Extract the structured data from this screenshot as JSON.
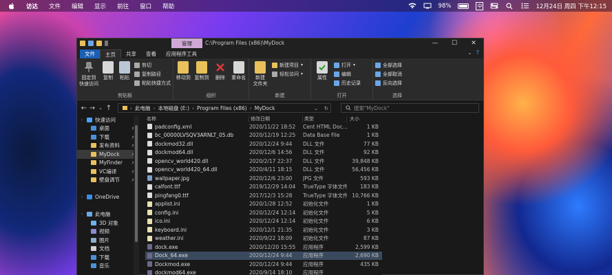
{
  "menubar": {
    "items": [
      "访达",
      "文件",
      "编辑",
      "显示",
      "前往",
      "窗口",
      "帮助"
    ],
    "battery": "98%",
    "ime": "中",
    "datetime": "12月24日 周四 下午12:15"
  },
  "window": {
    "context_tab": "管理",
    "title_path": "C:\\Program Files (x86)\\MyDock",
    "controls": {
      "minimize": "—",
      "maximize": "☐",
      "close": "✕"
    },
    "help": "?"
  },
  "ribbon_tabs": [
    "文件",
    "主页",
    "共享",
    "查看",
    "应用程序工具"
  ],
  "ribbon": {
    "clipboard": {
      "label": "剪贴板",
      "pin": "固定到\n快速访问",
      "copy": "复制",
      "paste": "粘贴",
      "cut": "剪切",
      "copy_path": "复制路径",
      "paste_shortcut": "粘贴快捷方式"
    },
    "organize": {
      "label": "组织",
      "move_to": "移动到",
      "copy_to": "复制到",
      "delete": "删除",
      "rename": "重命名"
    },
    "new": {
      "label": "新建",
      "new_folder": "新建\n文件夹",
      "new_item": "新建项目",
      "easy_access": "轻松访问"
    },
    "open": {
      "label": "打开",
      "properties": "属性",
      "open": "打开",
      "edit": "编辑",
      "history": "历史记录"
    },
    "select": {
      "label": "选择",
      "select_all": "全部选择",
      "select_none": "全部取消",
      "invert": "反向选择"
    }
  },
  "address": {
    "crumbs": [
      "此电脑",
      "本地磁盘 (E:)",
      "Program Files (x86)",
      "MyDock"
    ],
    "search_placeholder": "搜索\"MyDock\""
  },
  "nav": [
    {
      "label": "快速访问",
      "color": "#4aa3ff",
      "pin": false,
      "sel": false,
      "indent": 14
    },
    {
      "label": "桌面",
      "color": "#4a90d9",
      "pin": true,
      "sel": false,
      "indent": 20
    },
    {
      "label": "下载",
      "color": "#4a90d9",
      "pin": true,
      "sel": false,
      "indent": 20
    },
    {
      "label": "发布资料",
      "color": "#e8c15a",
      "pin": true,
      "sel": false,
      "indent": 20
    },
    {
      "label": "MyDock",
      "color": "#e8c15a",
      "pin": true,
      "sel": true,
      "indent": 20
    },
    {
      "label": "MyFinder",
      "color": "#e8c15a",
      "pin": true,
      "sel": false,
      "indent": 20
    },
    {
      "label": "VC编译",
      "color": "#e8c15a",
      "pin": true,
      "sel": false,
      "indent": 20
    },
    {
      "label": "壁盘调节",
      "color": "#e8c15a",
      "pin": true,
      "sel": false,
      "indent": 20
    },
    {
      "label": "",
      "color": "",
      "pin": false,
      "sel": false,
      "indent": 20
    },
    {
      "label": "OneDrive",
      "color": "#3a8ee6",
      "pin": false,
      "sel": false,
      "indent": 14
    },
    {
      "label": "",
      "color": "",
      "pin": false,
      "sel": false,
      "indent": 20
    },
    {
      "label": "此电脑",
      "color": "#6aa7e8",
      "pin": false,
      "sel": false,
      "indent": 14
    },
    {
      "label": "3D 对象",
      "color": "#6fb0e8",
      "pin": false,
      "sel": false,
      "indent": 20
    },
    {
      "label": "视频",
      "color": "#8a8ad0",
      "pin": false,
      "sel": false,
      "indent": 20
    },
    {
      "label": "图片",
      "color": "#8ab0d0",
      "pin": false,
      "sel": false,
      "indent": 20
    },
    {
      "label": "文档",
      "color": "#d0d0d0",
      "pin": false,
      "sel": false,
      "indent": 20
    },
    {
      "label": "下载",
      "color": "#4a90d9",
      "pin": false,
      "sel": false,
      "indent": 20
    },
    {
      "label": "音乐",
      "color": "#4a90d9",
      "pin": false,
      "sel": false,
      "indent": 20
    }
  ],
  "columns": {
    "name": "名称",
    "date": "修改日期",
    "type": "类型",
    "size": "大小"
  },
  "files": [
    {
      "name": "padconfig.xml",
      "date": "2020/11/22 18:52",
      "type": "Cent HTML Doc...",
      "size": "1 KB",
      "color": "#dddddd",
      "sel": false
    },
    {
      "name": "bc_00000LVSQV3ARNLT_05.db",
      "date": "2020/12/19 12:25",
      "type": "Data Base File",
      "size": "1 KB",
      "color": "#dddddd",
      "sel": false
    },
    {
      "name": "dockmod32.dll",
      "date": "2020/12/24 9:44",
      "type": "DLL 文件",
      "size": "77 KB",
      "color": "#dddddd",
      "sel": false
    },
    {
      "name": "dockmod64.dll",
      "date": "2020/12/6 14:56",
      "type": "DLL 文件",
      "size": "92 KB",
      "color": "#dddddd",
      "sel": false
    },
    {
      "name": "opencv_world420.dll",
      "date": "2020/2/17 22:37",
      "type": "DLL 文件",
      "size": "39,848 KB",
      "color": "#dddddd",
      "sel": false
    },
    {
      "name": "opencv_world420_64.dll",
      "date": "2020/4/11 18:15",
      "type": "DLL 文件",
      "size": "56,456 KB",
      "color": "#dddddd",
      "sel": false
    },
    {
      "name": "wallpaper.jpg",
      "date": "2020/12/6 23:00",
      "type": "JPG 文件",
      "size": "593 KB",
      "color": "#7aa0c8",
      "sel": false
    },
    {
      "name": "calfont.ttf",
      "date": "2019/12/29 14:04",
      "type": "TrueType 字体文件",
      "size": "183 KB",
      "color": "#dddddd",
      "sel": false
    },
    {
      "name": "pingfang0.ttf",
      "date": "2017/12/3 15:28",
      "type": "TrueType 字体文件",
      "size": "10,766 KB",
      "color": "#dddddd",
      "sel": false
    },
    {
      "name": "applist.ini",
      "date": "2020/1/28 12:52",
      "type": "初始化文件",
      "size": "1 KB",
      "color": "#e8e0b0",
      "sel": false
    },
    {
      "name": "config.ini",
      "date": "2020/12/24 12:14",
      "type": "初始化文件",
      "size": "5 KB",
      "color": "#e8e0b0",
      "sel": false
    },
    {
      "name": "ico.ini",
      "date": "2020/12/24 12:14",
      "type": "初始化文件",
      "size": "6 KB",
      "color": "#e8e0b0",
      "sel": false
    },
    {
      "name": "keyboard.ini",
      "date": "2020/12/1 21:35",
      "type": "初始化文件",
      "size": "3 KB",
      "color": "#e8e0b0",
      "sel": false
    },
    {
      "name": "weather.ini",
      "date": "2020/9/22 18:09",
      "type": "初始化文件",
      "size": "87 KB",
      "color": "#e8e0b0",
      "sel": false
    },
    {
      "name": "dock.exe",
      "date": "2020/12/20 15:55",
      "type": "应用程序",
      "size": "2,599 KB",
      "color": "#6a6a8a",
      "sel": false
    },
    {
      "name": "Dock_64.exe",
      "date": "2020/12/24 9:44",
      "type": "应用程序",
      "size": "2,690 KB",
      "color": "#6a6a8a",
      "sel": true
    },
    {
      "name": "Dockmod.exe",
      "date": "2020/12/24 9:44",
      "type": "应用程序",
      "size": "435 KB",
      "color": "#6a6a8a",
      "sel": false
    },
    {
      "name": "dockmod64.exe",
      "date": "2020/9/14 18:10",
      "type": "应用程序",
      "size": "",
      "color": "#6a6a8a",
      "sel": false
    }
  ]
}
